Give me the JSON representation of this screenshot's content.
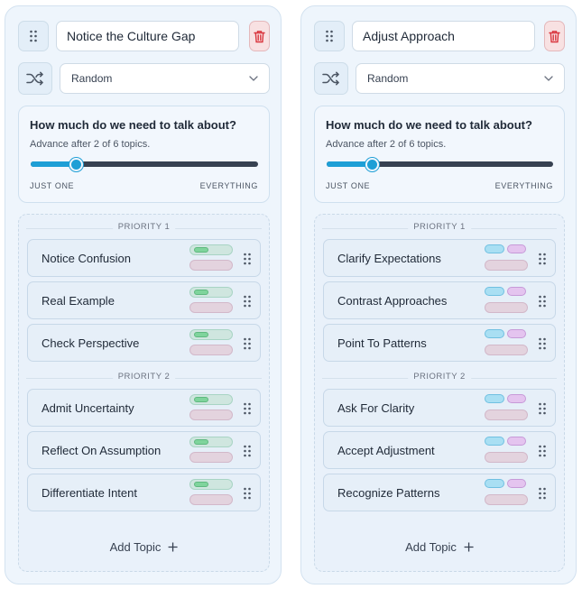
{
  "columns": [
    {
      "title_value": "Notice the Culture Gap",
      "order_mode": "Random",
      "amount_title": "How much do we need to talk about?",
      "amount_subtitle": "Advance after 2 of 6 topics.",
      "slider_fraction": 0.2,
      "slider_min_label": "JUST ONE",
      "slider_max_label": "EVERYTHING",
      "tag_style": "green",
      "groups": [
        {
          "label": "PRIORITY 1",
          "topics": [
            "Notice Confusion",
            "Real Example",
            "Check Perspective"
          ]
        },
        {
          "label": "PRIORITY 2",
          "topics": [
            "Admit Uncertainty",
            "Reflect On Assumption",
            "Differentiate Intent"
          ]
        }
      ],
      "add_topic_label": "Add Topic"
    },
    {
      "title_value": "Adjust Approach",
      "order_mode": "Random",
      "amount_title": "How much do we need to talk about?",
      "amount_subtitle": "Advance after 2 of 6 topics.",
      "slider_fraction": 0.2,
      "slider_min_label": "JUST ONE",
      "slider_max_label": "EVERYTHING",
      "tag_style": "duo",
      "groups": [
        {
          "label": "PRIORITY 1",
          "topics": [
            "Clarify Expectations",
            "Contrast Approaches",
            "Point To Patterns"
          ]
        },
        {
          "label": "PRIORITY 2",
          "topics": [
            "Ask For Clarity",
            "Accept Adjustment",
            "Recognize Patterns"
          ]
        }
      ],
      "add_topic_label": "Add Topic"
    }
  ],
  "icons": {
    "drag": "drag-handle-icon",
    "delete": "trash-icon",
    "shuffle": "shuffle-icon",
    "dropdown": "chevron-down-icon",
    "add": "plus-icon"
  },
  "colors": {
    "accent": "#1e9fd6",
    "delete": "#d9363e",
    "panel_bg": "#eef5fc"
  }
}
